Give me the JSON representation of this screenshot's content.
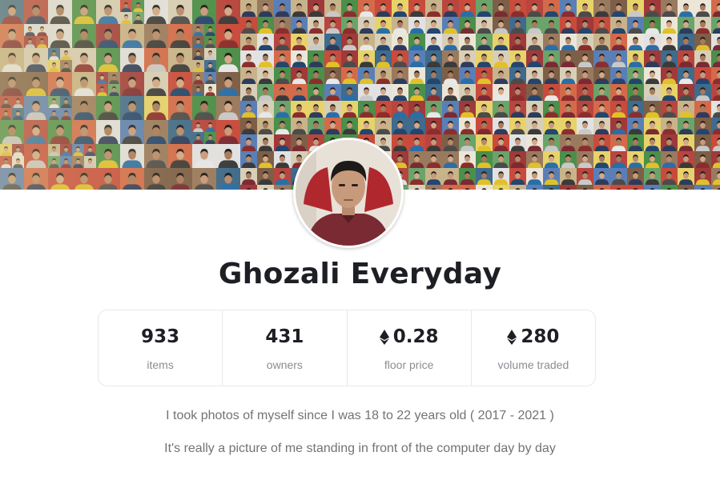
{
  "collection": {
    "name": "Ghozali Everyday",
    "banner_icon": "photo-mosaic-banner",
    "avatar_icon": "profile-photo-avatar"
  },
  "stats": [
    {
      "value": "933",
      "label": "items",
      "currency_icon": null
    },
    {
      "value": "431",
      "label": "owners",
      "currency_icon": null
    },
    {
      "value": "0.28",
      "label": "floor price",
      "currency_icon": "ethereum-icon"
    },
    {
      "value": "280",
      "label": "volume traded",
      "currency_icon": "ethereum-icon"
    }
  ],
  "description": [
    "I took photos of myself since I was 18 to 22 years old ( 2017 - 2021 )",
    "It's really a picture of me standing in front of the computer day by day"
  ],
  "colors": {
    "title": "#1d1f24",
    "label": "#8a8d93",
    "border": "#e7e8ea"
  }
}
